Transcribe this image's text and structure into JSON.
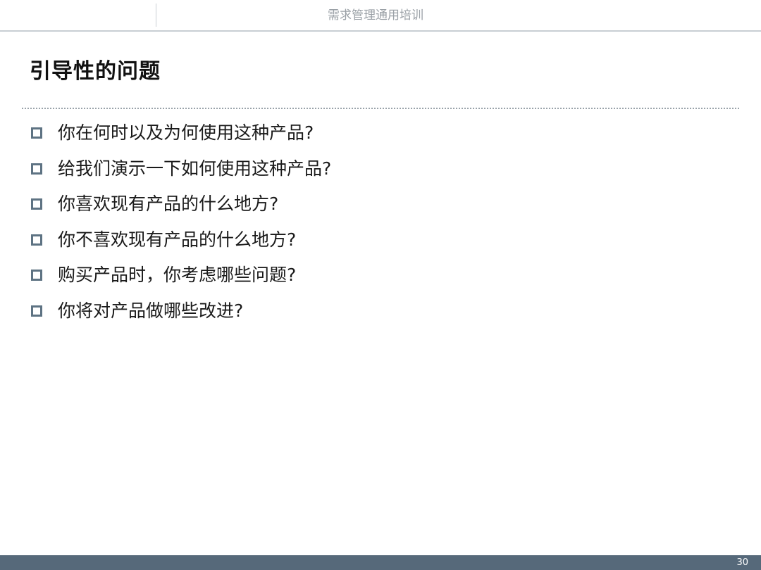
{
  "header": {
    "course_title": "需求管理通用培训"
  },
  "slide": {
    "title": "引导性的问题",
    "bullets": [
      "你在何时以及为何使用这种产品?",
      "给我们演示一下如何使用这种产品?",
      "你喜欢现有产品的什么地方?",
      "你不喜欢现有产品的什么地方?",
      "购买产品时，你考虑哪些问题?",
      "你将对产品做哪些改进?"
    ]
  },
  "footer": {
    "page_number": "30"
  },
  "colors": {
    "bullet_marker": "#5e7383",
    "footer_bar": "#56697a",
    "header_text": "#9aa0a6"
  }
}
